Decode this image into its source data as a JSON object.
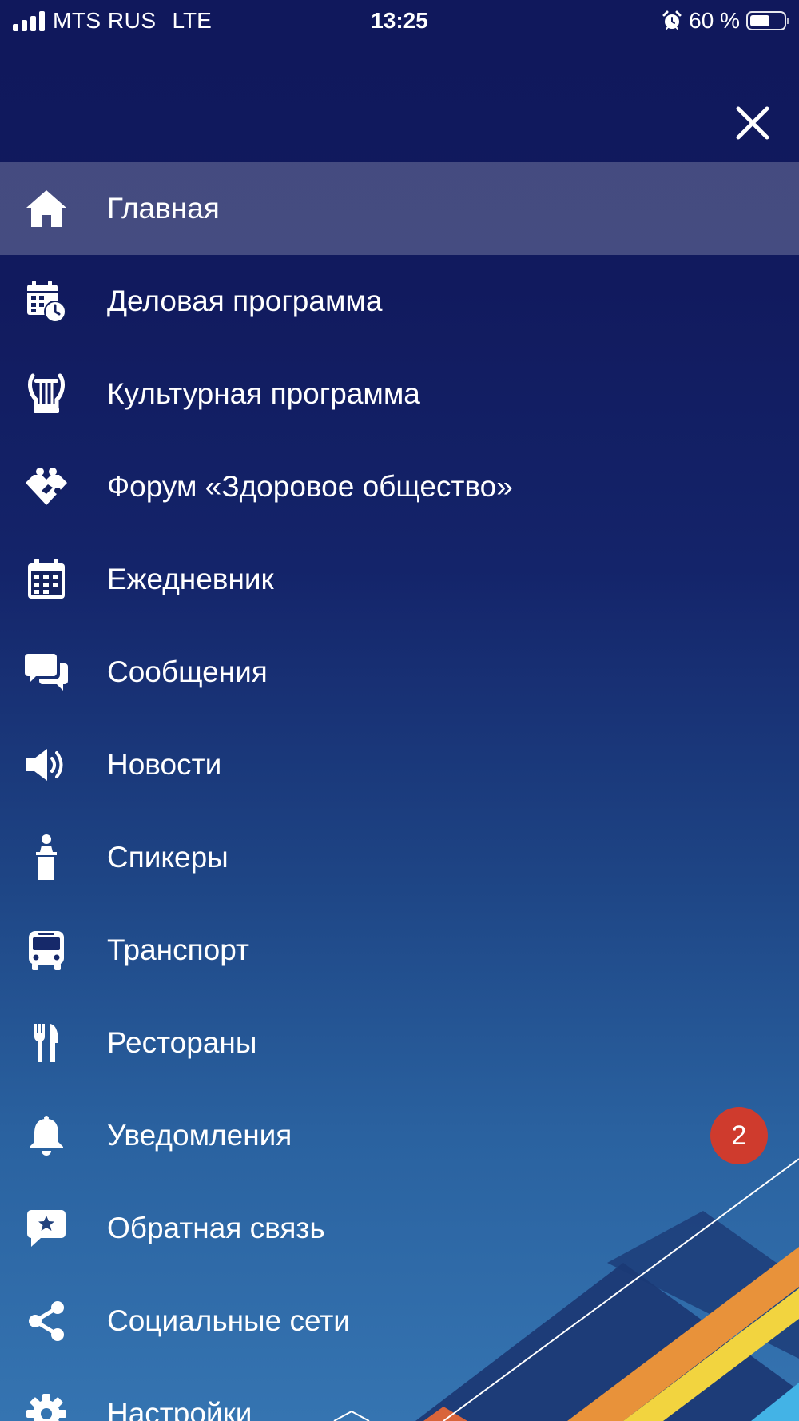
{
  "status_bar": {
    "carrier": "MTS RUS",
    "network": "LTE",
    "time": "13:25",
    "battery_percent": "60 %",
    "battery_level": 0.6,
    "icons": [
      "signal-icon",
      "alarm-icon",
      "battery-icon"
    ]
  },
  "header": {
    "close_icon": "close-icon"
  },
  "menu": {
    "items": [
      {
        "label": "Главная",
        "icon": "home-icon",
        "active": true
      },
      {
        "label": "Деловая программа",
        "icon": "calendar-clock-icon"
      },
      {
        "label": "Культурная программа",
        "icon": "lyre-icon"
      },
      {
        "label": "Форум «Здоровое общество»",
        "icon": "heart-people-icon"
      },
      {
        "label": "Ежедневник",
        "icon": "calendar-icon"
      },
      {
        "label": "Сообщения",
        "icon": "chat-icon"
      },
      {
        "label": "Новости",
        "icon": "speaker-icon"
      },
      {
        "label": "Спикеры",
        "icon": "speaker-podium-icon"
      },
      {
        "label": "Транспорт",
        "icon": "bus-icon"
      },
      {
        "label": "Рестораны",
        "icon": "cutlery-icon"
      },
      {
        "label": "Уведомления",
        "icon": "bell-icon",
        "badge": "2"
      },
      {
        "label": "Обратная связь",
        "icon": "feedback-icon"
      },
      {
        "label": "Социальные сети",
        "icon": "share-icon"
      },
      {
        "label": "Настройки",
        "icon": "gear-icon"
      }
    ]
  },
  "colors": {
    "background_top": "#10185c",
    "background_bottom": "#3574b1",
    "active_highlight": "rgba(255,255,255,0.22)",
    "badge": "#cf3b2d",
    "text": "#ffffff",
    "accent_yellow": "#f2d43f",
    "accent_orange": "#e8923a"
  }
}
